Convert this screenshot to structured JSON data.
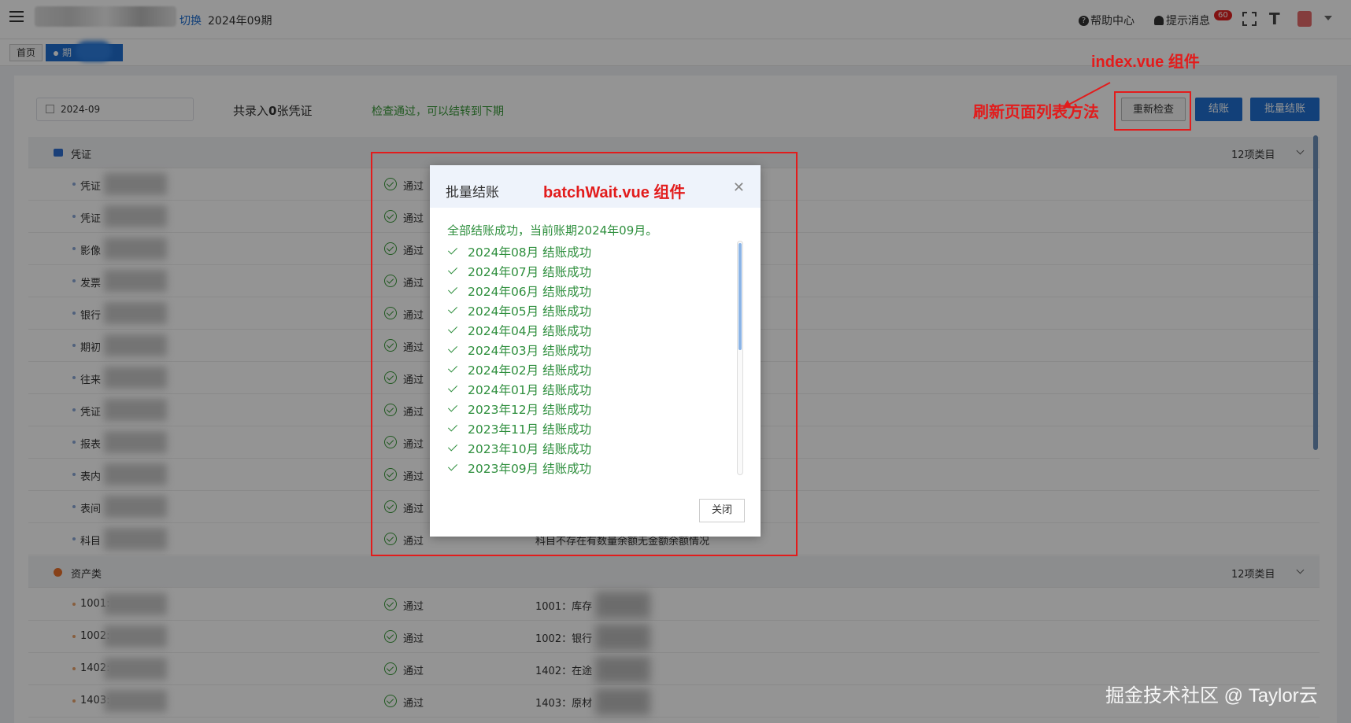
{
  "header": {
    "switch_label": "切换",
    "period": "2024年09期",
    "help_label": "帮助中心",
    "notice_label": "提示消息",
    "notice_count": "60"
  },
  "tabs": {
    "home": "首页",
    "active": "期"
  },
  "toolbar": {
    "date_value": "2024-09",
    "summary_prefix": "共录入",
    "summary_count": "0",
    "summary_suffix": "张凭证",
    "check_message": "检查通过，可以结转到下期",
    "recheck_label": "重新检查",
    "close_account_label": "结账",
    "batch_close_label": "批量结账"
  },
  "groups": [
    {
      "name": "凭证",
      "count_label": "12项类目",
      "icon_color": "#2f6fd1",
      "rows": [
        {
          "name": "凭证",
          "status": "通过",
          "desc": ""
        },
        {
          "name": "凭证",
          "status": "通过",
          "desc": ""
        },
        {
          "name": "影像",
          "status": "通过",
          "desc": ""
        },
        {
          "name": "发票",
          "status": "通过",
          "desc": ""
        },
        {
          "name": "银行",
          "status": "通过",
          "desc": ""
        },
        {
          "name": "期初",
          "status": "通过",
          "desc": ""
        },
        {
          "name": "往来",
          "status": "通过",
          "desc": ""
        },
        {
          "name": "凭证",
          "status": "通过",
          "desc": ""
        },
        {
          "name": "报表",
          "status": "通过",
          "desc": ""
        },
        {
          "name": "表内",
          "status": "通过",
          "desc": ""
        },
        {
          "name": "表间",
          "status": "通过",
          "desc": ""
        },
        {
          "name": "科目",
          "status": "通过",
          "desc": "科目不存在有数量余额无金额余额情况"
        }
      ]
    },
    {
      "name": "资产类",
      "count_label": "12项类目",
      "icon_color": "#e8712c",
      "rows": [
        {
          "name": "1001:",
          "status": "通过",
          "desc": "1001：库存"
        },
        {
          "name": "1002:",
          "status": "通过",
          "desc": "1002：银行"
        },
        {
          "name": "1402:",
          "status": "通过",
          "desc": "1402：在途"
        },
        {
          "name": "1403:",
          "status": "通过",
          "desc": "1403：原材"
        }
      ]
    }
  ],
  "modal": {
    "title": "批量结账",
    "success_message": "全部结账成功，当前账期2024年09月。",
    "months": [
      "2024年08月 结账成功",
      "2024年07月 结账成功",
      "2024年06月 结账成功",
      "2024年05月 结账成功",
      "2024年04月 结账成功",
      "2024年03月 结账成功",
      "2024年02月 结账成功",
      "2024年01月 结账成功",
      "2023年12月 结账成功",
      "2023年11月 结账成功",
      "2023年10月 结账成功",
      "2023年09月 结账成功"
    ],
    "close_label": "关闭"
  },
  "annotations": {
    "index_label": "index.vue 组件",
    "refresh_label": "刷新页面列表方法",
    "batch_label": "batchWait.vue 组件",
    "color": "#e21c1c"
  },
  "watermark": "掘金技术社区 @ Taylor云"
}
